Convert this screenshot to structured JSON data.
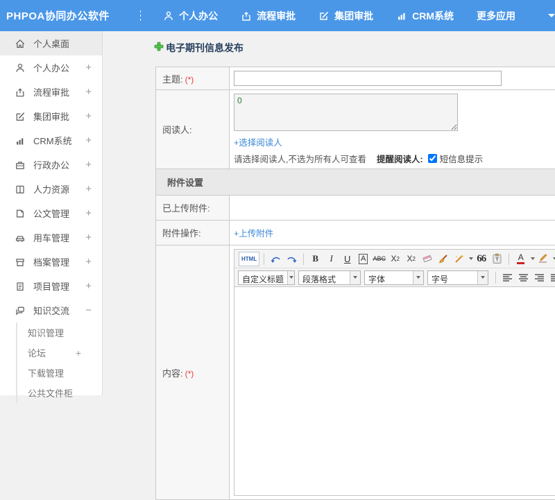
{
  "colors": {
    "topbar": "#4a97e8",
    "link": "#3a87d6",
    "title": "#28405f",
    "required": "#e23b3b",
    "reader_count": "#2c7a2c"
  },
  "topbar": {
    "logo": "PHPOA协同办公软件",
    "nav": [
      {
        "label": "个人办公",
        "icon": "person-icon"
      },
      {
        "label": "流程审批",
        "icon": "workflow-icon"
      },
      {
        "label": "集团审批",
        "icon": "edit-square-icon"
      },
      {
        "label": "CRM系统",
        "icon": "bar-chart-icon"
      },
      {
        "label": "更多应用",
        "icon": "chevron-down-icon"
      }
    ]
  },
  "sidebar": {
    "items": [
      {
        "label": "个人桌面",
        "toggle": "",
        "icon": "home-icon",
        "active": true
      },
      {
        "label": "个人办公",
        "toggle": "+",
        "icon": "person-icon"
      },
      {
        "label": "流程审批",
        "toggle": "+",
        "icon": "workflow-icon"
      },
      {
        "label": "集团审批",
        "toggle": "+",
        "icon": "edit-square-icon"
      },
      {
        "label": "CRM系统",
        "toggle": "+",
        "icon": "bar-chart-icon"
      },
      {
        "label": "行政办公",
        "toggle": "+",
        "icon": "briefcase-icon"
      },
      {
        "label": "人力资源",
        "toggle": "+",
        "icon": "book-icon"
      },
      {
        "label": "公文管理",
        "toggle": "+",
        "icon": "document-icon"
      },
      {
        "label": "用车管理",
        "toggle": "+",
        "icon": "car-icon"
      },
      {
        "label": "档案管理",
        "toggle": "+",
        "icon": "archive-icon"
      },
      {
        "label": "项目管理",
        "toggle": "+",
        "icon": "clipboard-icon"
      },
      {
        "label": "知识交流",
        "toggle": "−",
        "icon": "chat-icon",
        "expanded": true
      }
    ],
    "subitems": [
      {
        "label": "知识管理",
        "toggle": ""
      },
      {
        "label": "论坛",
        "toggle": "+"
      },
      {
        "label": "下载管理",
        "toggle": ""
      },
      {
        "label": "公共文件柜",
        "toggle": ""
      }
    ]
  },
  "main": {
    "page_title": "电子期刊信息发布",
    "form": {
      "subject_label": "主题:",
      "required_mark": "(*)",
      "readers_label": "阅读人:",
      "readers_value": "0",
      "select_readers_link": "+选择阅读人",
      "readers_hint": "请选择阅读人,不选为所有人可查看",
      "remind_label": "提醒阅读人:",
      "sms_label": "短信息提示",
      "sms_checked": true,
      "attachment_section_title": "附件设置",
      "uploaded_label": "已上传附件:",
      "attachment_action_label": "附件操作:",
      "upload_link": "+上传附件",
      "content_label": "内容:"
    },
    "editor": {
      "html_btn": "HTML",
      "bold": "B",
      "italic": "I",
      "underline": "U",
      "border_a": "A",
      "strike": "ABC",
      "sup_base": "X",
      "sup_exp": "2",
      "sub_base": "X",
      "sub_idx": "2",
      "quote": "66",
      "font_color_letter": "A",
      "heading_select": "自定义标题",
      "paragraph_select": "段落格式",
      "font_select": "字体",
      "size_select": "字号"
    }
  }
}
